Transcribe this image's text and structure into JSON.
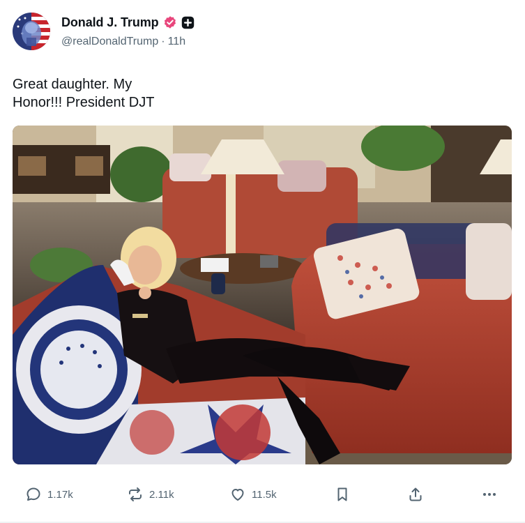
{
  "author": {
    "display_name": "Donald J. Trump",
    "handle": "@realDonaldTrump",
    "separator": "·",
    "time": "11h",
    "avatar_icon": "flag-portrait-avatar",
    "verified_icon": "verified-badge-icon",
    "verified_color": "#e8467c",
    "plus_icon": "plus-badge-icon"
  },
  "post": {
    "lines": [
      "Great daughter. My",
      "Honor!!! President DJT"
    ],
    "media_icon": "photo-woman-on-sofa"
  },
  "actions": {
    "replies": "1.17k",
    "retruths": "2.11k",
    "likes": "11.5k"
  },
  "colors": {
    "text": "#0f1419",
    "muted": "#536471"
  }
}
